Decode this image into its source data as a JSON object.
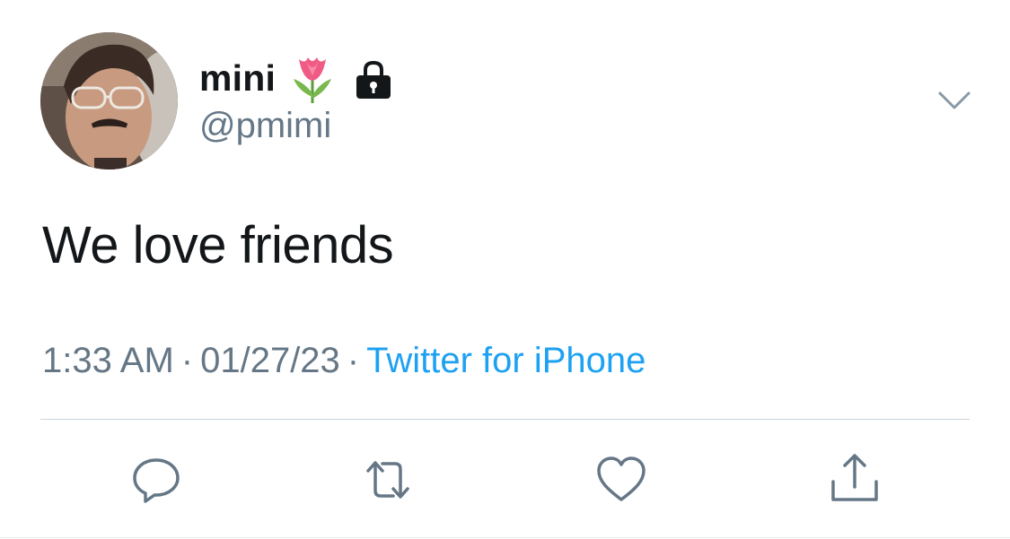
{
  "user": {
    "display_name": "mini",
    "name_emoji": "tulip-icon",
    "protected_icon": "lock-icon",
    "handle": "@pmimi"
  },
  "tweet": {
    "text": "We love friends"
  },
  "meta": {
    "time": "1:33 AM",
    "separator": "·",
    "date": "01/27/23",
    "source": "Twitter for iPhone"
  },
  "actions": {
    "reply": "reply-icon",
    "retweet": "retweet-icon",
    "like": "heart-icon",
    "share": "share-icon"
  },
  "colors": {
    "text": "#14171a",
    "secondary": "#657786",
    "link": "#1da1f2",
    "divider": "#ccd6dd"
  }
}
